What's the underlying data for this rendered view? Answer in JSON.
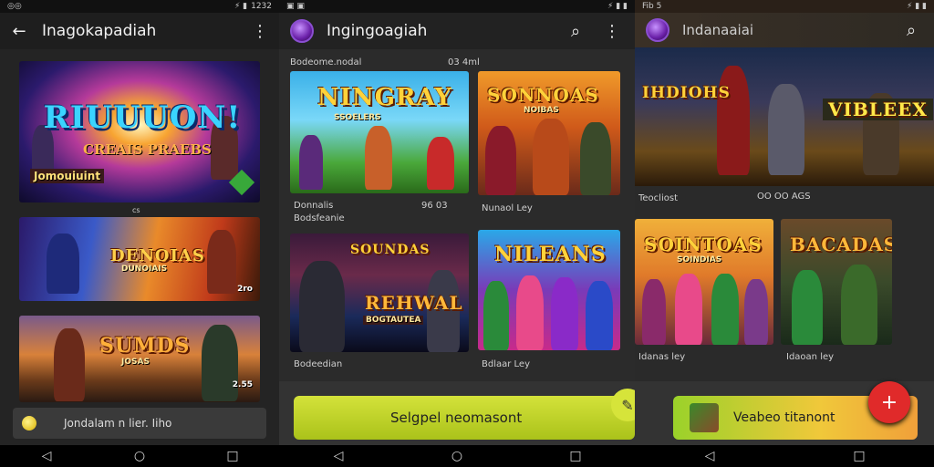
{
  "status_bar": {
    "s1_time": "1232",
    "s3_left": "Fib 5"
  },
  "screen1": {
    "title": "Inagokapadiah",
    "cards": [
      {
        "title": "RIUUUON!",
        "subtitle": "CREAIS PRAEBS",
        "badge": "Jomouiuint"
      },
      {
        "title": "DENOIAS",
        "subtitle": "DUNOIAIS"
      },
      {
        "title": "SUMDS",
        "subtitle": "JOSAS"
      }
    ],
    "small_texts": [
      "cs",
      "2ro",
      "2.55"
    ],
    "bottom_text": "Jondalam n lier. Iiho"
  },
  "screen2": {
    "title": "Ingingoagiah",
    "header_left": "Bodeome.nodal",
    "header_right": "03 4ml",
    "cards": [
      {
        "title": "NINGRAY",
        "subtitle": "SSOELERS",
        "meta1": "Donnalis",
        "meta2": "Bodsfeanie",
        "price": "96 03"
      },
      {
        "title": "SONNOAS",
        "subtitle": "NOIBAS",
        "meta1": "Nunaol Ley"
      },
      {
        "title": "SOUNDAS",
        "subtitle": "REHWAL",
        "subtitle2": "BOGTAUTEA",
        "meta1": "Bodeedian"
      },
      {
        "title": "NILEANS",
        "subtitle": "",
        "meta1": "Bdlaar Ley"
      }
    ],
    "cta": "Selgpel neomasont"
  },
  "screen3": {
    "title": "Indanaaiai",
    "cards": [
      {
        "title": "IHDIOHS",
        "subtitle": "VIBLEEX",
        "meta1": "Teocliost",
        "meta2": "OO OO AGS"
      },
      {
        "title": "SOINTOAS",
        "subtitle": "SOINDIAS",
        "meta1": "Idanas ley"
      },
      {
        "title": "BACADAS",
        "subtitle": "",
        "meta1": "Idaoan ley"
      }
    ],
    "cta": "Veabeo titanont"
  },
  "colors": {
    "accent_green": "#b8cf22",
    "fab_red": "#e02a2a",
    "bg_dark": "#242424"
  },
  "icons": [
    "back-arrow-icon",
    "more-vert-icon",
    "search-icon",
    "android-back-icon",
    "home-icon",
    "recents-icon",
    "plus-icon",
    "pencil-icon"
  ]
}
